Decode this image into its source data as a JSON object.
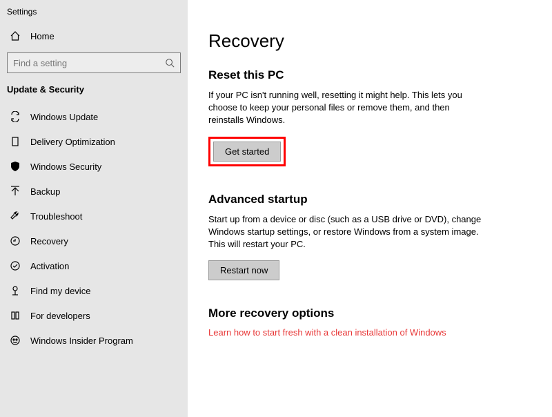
{
  "app_title": "Settings",
  "home_label": "Home",
  "search_placeholder": "Find a setting",
  "section_label": "Update & Security",
  "nav": [
    {
      "id": "windows-update",
      "label": "Windows Update"
    },
    {
      "id": "delivery-optimization",
      "label": "Delivery Optimization"
    },
    {
      "id": "windows-security",
      "label": "Windows Security"
    },
    {
      "id": "backup",
      "label": "Backup"
    },
    {
      "id": "troubleshoot",
      "label": "Troubleshoot"
    },
    {
      "id": "recovery",
      "label": "Recovery"
    },
    {
      "id": "activation",
      "label": "Activation"
    },
    {
      "id": "find-my-device",
      "label": "Find my device"
    },
    {
      "id": "for-developers",
      "label": "For developers"
    },
    {
      "id": "windows-insider-program",
      "label": "Windows Insider Program"
    }
  ],
  "main": {
    "title": "Recovery",
    "reset": {
      "heading": "Reset this PC",
      "body": "If your PC isn't running well, resetting it might help. This lets you choose to keep your personal files or remove them, and then reinstalls Windows.",
      "button": "Get started"
    },
    "advanced": {
      "heading": "Advanced startup",
      "body": "Start up from a device or disc (such as a USB drive or DVD), change Windows startup settings, or restore Windows from a system image. This will restart your PC.",
      "button": "Restart now"
    },
    "more": {
      "heading": "More recovery options",
      "link": "Learn how to start fresh with a clean installation of Windows"
    }
  }
}
